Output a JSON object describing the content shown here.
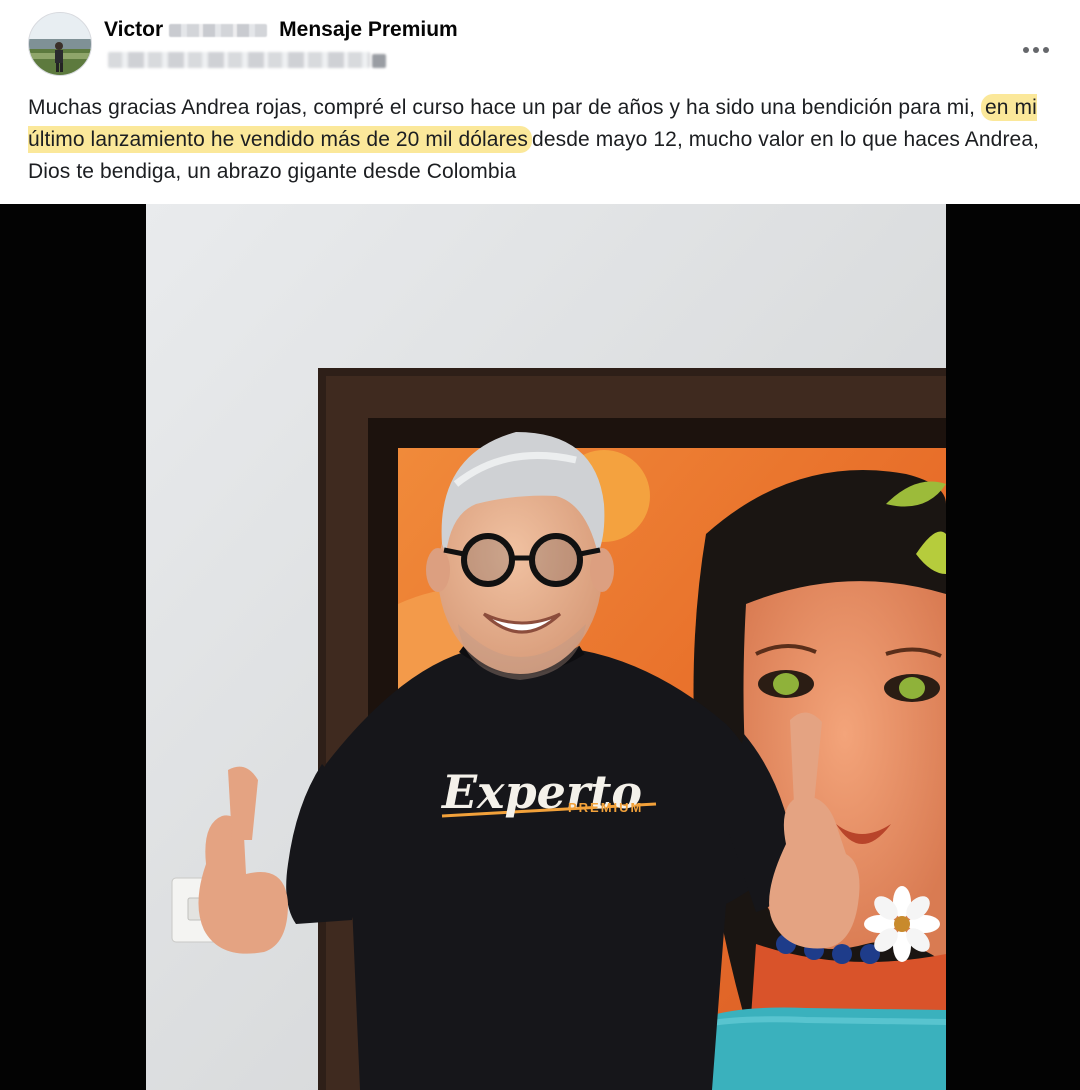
{
  "post": {
    "author_name": "Victor",
    "group_name": "Mensaje Premium",
    "more_icon": "more-horizontal-icon",
    "text": {
      "before": "Muchas gracias Andrea rojas, compré el curso hace un par de años y ha sido una bendición para mi,",
      "highlight": "en mi último lanzamiento he vendido más de 20 mil dólares",
      "after": "desde mayo 12, mucho valor en lo que haces Andrea, Dios te bendiga, un abrazo gigante desde Colombia"
    },
    "shirt": {
      "brand": "Experto",
      "tier": "PREMIUM"
    },
    "colors": {
      "highlight": "#fbe89a",
      "shirt_accent": "#f2a13a",
      "shirt_body": "#16161a",
      "painting_orange": "#ef7f2e",
      "media_background": "#030303"
    }
  }
}
